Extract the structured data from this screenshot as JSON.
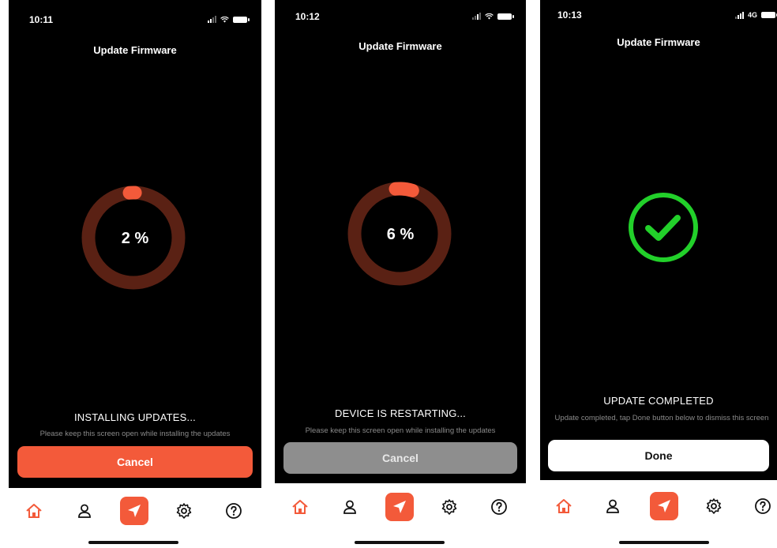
{
  "colors": {
    "accent": "#f35a3a",
    "ring_track": "#5a2114",
    "success": "#22d02a",
    "background": "#000000",
    "tabbar": "#ffffff"
  },
  "screens": [
    {
      "time": "10:11",
      "title": "Update Firmware",
      "progress_text": "2 %",
      "progress_value": 0.02,
      "status_title": "INSTALLING UPDATES...",
      "status_sub": "Please keep this screen open while installing the updates",
      "button_label": "Cancel",
      "icons": [
        "home-icon",
        "person-icon",
        "navigation-arrow-icon",
        "gear-icon",
        "help-icon"
      ]
    },
    {
      "time": "10:12",
      "title": "Update Firmware",
      "progress_text": "6 %",
      "progress_value": 0.06,
      "status_title": "DEVICE IS RESTARTING...",
      "status_sub": "Please keep this screen open while installing the updates",
      "button_label": "Cancel",
      "icons": [
        "home-icon",
        "person-icon",
        "navigation-arrow-icon",
        "gear-icon",
        "help-icon"
      ]
    },
    {
      "time": "10:13",
      "network": "4G",
      "title": "Update Firmware",
      "status_title": "UPDATE COMPLETED",
      "status_sub": "Update completed, tap Done button below to dismiss this screen",
      "button_label": "Done",
      "icons": [
        "checkmark-circle-icon",
        "home-icon",
        "person-icon",
        "navigation-arrow-icon",
        "gear-icon",
        "help-icon"
      ]
    }
  ]
}
